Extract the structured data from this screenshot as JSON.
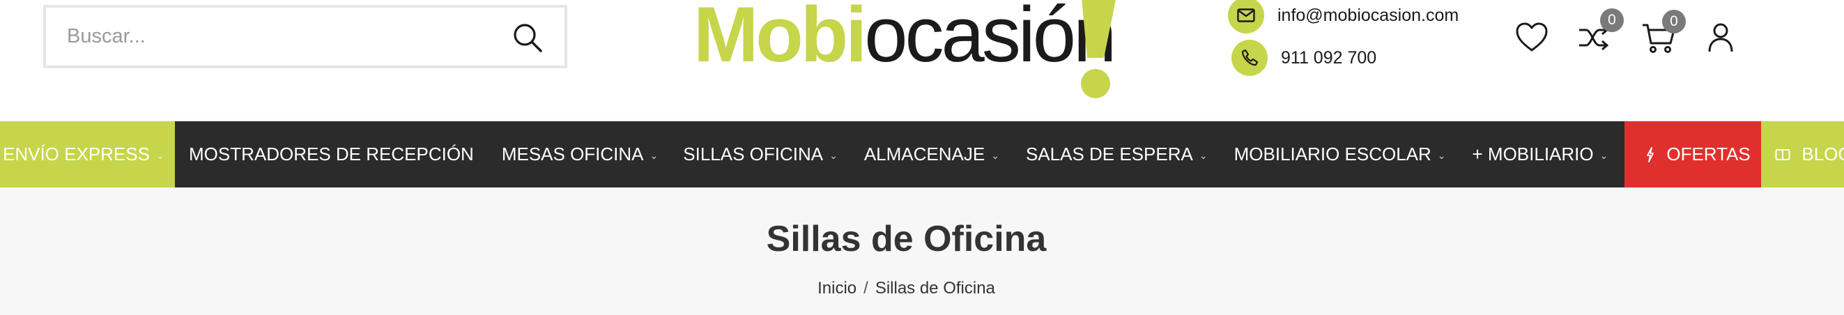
{
  "colors": {
    "accent": "#c6d54a",
    "nav_bg": "#2b2b2b",
    "offers_bg": "#e0302e",
    "title_band_bg": "#f7f7f7",
    "badge_bg": "#7a7a7a"
  },
  "search": {
    "placeholder": "Buscar...",
    "icon": "search-icon"
  },
  "logo": {
    "part1": "Mobi",
    "part2": "ocasión"
  },
  "contact": {
    "email": "info@mobiocasion.com",
    "email_icon": "envelope-icon",
    "phone": "911 092 700",
    "phone_icon": "phone-icon"
  },
  "header_actions": {
    "wishlist_icon": "heart-icon",
    "compare_icon": "shuffle-icon",
    "compare_count": "0",
    "cart_icon": "cart-icon",
    "cart_count": "0",
    "account_icon": "user-icon"
  },
  "nav": {
    "items": [
      {
        "label": "ENVÍO EXPRESS"
      },
      {
        "label": "MOSTRADORES DE RECEPCIÓN"
      },
      {
        "label": "MESAS OFICINA"
      },
      {
        "label": "SILLAS OFICINA"
      },
      {
        "label": "ALMACENAJE"
      },
      {
        "label": "SALAS DE ESPERA"
      },
      {
        "label": "MOBILIARIO ESCOLAR"
      },
      {
        "label": "+ MOBILIARIO"
      },
      {
        "label": "OFERTAS",
        "icon": "flash-icon"
      },
      {
        "label": "BLOG",
        "icon": "book-icon"
      }
    ]
  },
  "page": {
    "title": "Sillas de Oficina",
    "breadcrumb": {
      "home": "Inicio",
      "separator": "/",
      "current": "Sillas de Oficina"
    }
  }
}
